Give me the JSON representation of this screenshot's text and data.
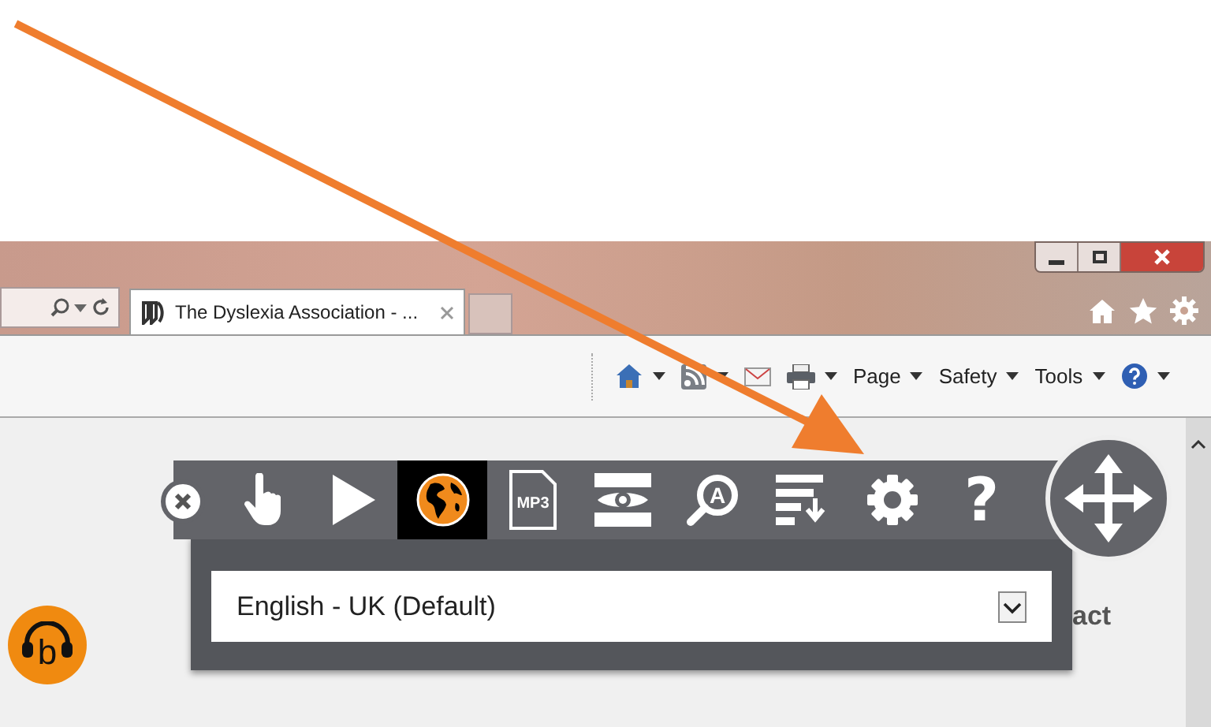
{
  "browser": {
    "tab": {
      "title": "The Dyslexia Association - ...",
      "selected": true
    },
    "command_bar": [
      {
        "kind": "home",
        "dropdown": true
      },
      {
        "kind": "feeds",
        "dropdown": true
      },
      {
        "kind": "mail",
        "dropdown": false
      },
      {
        "kind": "print",
        "dropdown": true
      },
      {
        "kind": "menu",
        "label": "Page",
        "dropdown": true
      },
      {
        "kind": "menu",
        "label": "Safety",
        "dropdown": true
      },
      {
        "kind": "menu",
        "label": "Tools",
        "dropdown": true
      },
      {
        "kind": "help",
        "dropdown": true
      }
    ]
  },
  "page": {
    "logo_letter": "b",
    "partial_text": "act"
  },
  "reader_toolbar": {
    "buttons": [
      {
        "kind": "hand",
        "selected": false
      },
      {
        "kind": "play",
        "selected": false
      },
      {
        "kind": "globe",
        "selected": true
      },
      {
        "kind": "mp3",
        "label": "MP3",
        "selected": false
      },
      {
        "kind": "eye",
        "selected": false
      },
      {
        "kind": "magnify",
        "label": "A",
        "selected": false
      },
      {
        "kind": "sort",
        "selected": false
      },
      {
        "kind": "settings",
        "selected": false
      },
      {
        "kind": "help",
        "label": "?",
        "selected": false
      }
    ],
    "language_select": {
      "value": "English - UK (Default)"
    }
  }
}
